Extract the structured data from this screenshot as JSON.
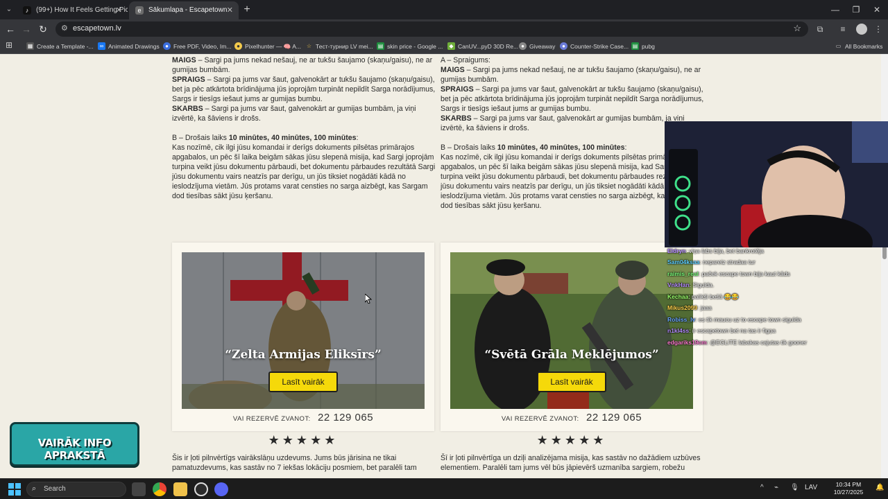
{
  "browser": {
    "tabs": [
      {
        "title": "(99+) How It Feels Getting Picke",
        "active": false
      },
      {
        "title": "Sākumlapa - Escapetown",
        "active": true
      }
    ],
    "url": "escapetown.lv",
    "bookmarks": [
      {
        "label": "Create a Template -..."
      },
      {
        "label": "Animated Drawings"
      },
      {
        "label": "Free PDF, Video, Im..."
      },
      {
        "label": "Pixelhunter — 🧠 A..."
      },
      {
        "label": "Тест-турнир LV mei..."
      },
      {
        "label": "skin price - Google ..."
      },
      {
        "label": "CanUV...pyD 30D Re..."
      },
      {
        "label": "Giveaway"
      },
      {
        "label": "Counter-Strike Case..."
      },
      {
        "label": "pubg"
      }
    ],
    "all_bookmarks": "All Bookmarks"
  },
  "left_text": {
    "line_1_b": "MAIGS",
    "line_1": " – Sargi pa jums nekad nešauj, ne ar tukšu šaujamo (skaņu/gaisu), ne ar gumijas bumbām.",
    "line_2_b": "SPRAIGS",
    "line_2": " – Sargi pa jums var šaut, galvenokārt ar tukšu šaujamo (skaņu/gaisu), bet ja pēc atkārtota brīdinājuma jūs joprojām turpināt nepildīt Sarga norādījumus, Sargs ir tiesīgs iešaut jums ar gumijas bumbu.",
    "line_3_b": "SKARBS",
    "line_3": " – Sargi pa jums var šaut, galvenokārt ar gumijas bumbām, ja viņi izvērtē, ka šāviens ir drošs.",
    "safe_prefix": "B – Drošais laiks ",
    "safe_times": "10 minūtes, 40 minūtes, 100 minūtes",
    "safe_suffix": ":",
    "safe_desc": "Kas nozīmē, cik ilgi jūsu komandai ir derīgs dokuments pilsētas primārajos apgabalos, un pēc šī laika beigām sākas jūsu slepenā misija, kad Sargi joprojām turpina veikt jūsu dokumentu pārbaudi, bet dokumentu pārbaudes rezultātā Sargi jūsu dokumentu vairs neatzīs par derīgu, un jūs tiksiet nogādāti kādā no ieslodzījuma vietām. Jūs protams varat censties no sarga aizbēgt, kas Sargam dod tiesības sākt jūsu ķeršanu."
  },
  "right_text": {
    "intro": "A – Spraigums:",
    "line_1_b": "MAIGS",
    "line_1": " – Sargi pa jums nekad nešauj, ne ar tukšu šaujamo (skaņu/gaisu), ne ar gumijas bumbām.",
    "line_2_b": "SPRAIGS",
    "line_2": " – Sargi pa jums var šaut, galvenokārt ar tukšu šaujamo (skaņu/gaisu), bet ja pēc atkārtota brīdinājuma jūs joprojām turpināt nepildīt Sarga norādījumus, Sargs ir tiesīgs iešaut jums ar gumijas bumbu.",
    "line_3_b": "SKARBS",
    "line_3": " – Sargi pa jums var šaut, galvenokārt ar gumijas bumbām, ja viņi izvērtē, ka šāviens ir drošs.",
    "safe_prefix": "B – Drošais laiks ",
    "safe_times": "10 minūtes, 40 minūtes, 100 minūtes",
    "safe_suffix": ":",
    "safe_desc": "Kas nozīmē, cik ilgi jūsu komandai ir derīgs dokuments pilsētas primārajos apgabalos, un pēc šī laika beigām sākas jūsu slepenā misija, kad Sargi joprojām turpina veikt jūsu dokumentu pārbaudi, bet dokumentu pārbaudes rezultātā Sargi jūsu dokumentu vairs neatzīs par derīgu, un jūs tiksiet nogādāti kādā no ieslodzījuma vietām. Jūs protams varat censties no sarga aizbēgt, kas Sargam dod tiesības sākt jūsu ķeršanu."
  },
  "cards": [
    {
      "title": "“Zelta Armijas Eliksīrs”",
      "button": "Lasīt vairāk",
      "phone_label": "VAI REZERVĒ ZVANOT:",
      "phone": "22 129 065",
      "stars": "★★★★★",
      "desc": "Šis ir ļoti pilnvērtīgs vairākslāņu uzdevums. Jums būs jārisina ne tikai pamatuzdevums, kas sastāv no 7 iekšas lokāciju posmiem, bet paralēli tam"
    },
    {
      "title": "“Svētā Grāla Meklējumos”",
      "button": "Lasīt vairāk",
      "phone_label": "VAI REZERVĒ ZVANOT:",
      "phone": "22 129 065",
      "stars": "★★★★★",
      "desc": "Šī ir ļoti pilnvērtīga un dziļi analizējama misija, kas sastāv no dažādiem uzbūves elementiem. Paralēli tam jums vēl būs jāpievērš uzmanība sargiem, robežu"
    }
  ],
  "chat": [
    {
      "user": "Eldryn",
      "msg": ": viņa labs bija, bet bankrotēja",
      "color": "#b48cff"
    },
    {
      "user": "Sam04ksaa",
      "msg": ": nepareiz stradaa tur",
      "color": "#5fd0ff"
    },
    {
      "user": "raimis_real",
      "msg": ": paček escape town bija kaut kāds",
      "color": "#7dff7d"
    },
    {
      "user": "VnkHan",
      "msg": ": Sigulda.",
      "color": "#b48cff"
    },
    {
      "user": "Kechaa",
      "msg": ": palikši bešā 😂😂",
      "color": "#9aff6a"
    },
    {
      "user": "Mikus2099",
      "msg": ": jaaa",
      "color": "#ffd24d"
    },
    {
      "user": "Robiss_lv",
      "msg": ": es tik maucu uz to escape town sigulda",
      "color": "#6aa6ff"
    },
    {
      "user": "n1kl4ss",
      "msg": ": ir escapetown bet na tas ir figņa",
      "color": "#b48cff"
    },
    {
      "user": "edgariks19cm",
      "msg": ": @EGLITE labakas cajutas tik gooner",
      "color": "#ff7ad1"
    }
  ],
  "overlay": {
    "info_badge": "VAIRĀK INFO APRAKSTĀ"
  },
  "taskbar": {
    "search_placeholder": "Search",
    "lang": "LAV",
    "time": "10:34 PM",
    "date": "10/27/2025"
  },
  "colors": {
    "page_bg": "#f1eee4",
    "button_yellow": "#f5d90a",
    "badge_teal": "#2aa6a6"
  }
}
